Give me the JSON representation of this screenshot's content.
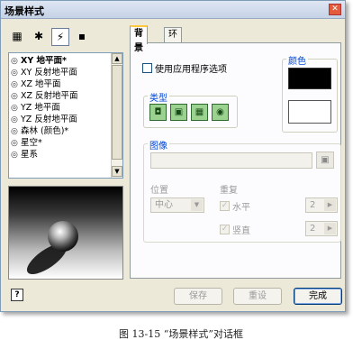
{
  "window": {
    "title": "场景样式",
    "close_glyph": "✕"
  },
  "left_toolbar": {
    "icons": [
      {
        "name": "scene-styles-icon",
        "glyph": "▦"
      },
      {
        "name": "lights-icon",
        "glyph": "✱"
      },
      {
        "name": "sunlight-icon",
        "glyph": "⚡"
      },
      {
        "name": "background-icon",
        "glyph": "▪"
      }
    ]
  },
  "scene_list": {
    "items": [
      {
        "label": "XY 地平面*",
        "selected": true
      },
      {
        "label": "XY 反射地平面",
        "selected": false
      },
      {
        "label": "XZ 地平面",
        "selected": false
      },
      {
        "label": "XZ 反射地平面",
        "selected": false
      },
      {
        "label": "YZ 地平面",
        "selected": false
      },
      {
        "label": "YZ 反射地平面",
        "selected": false
      },
      {
        "label": "森林 (颜色)*",
        "selected": false
      },
      {
        "label": "星空*",
        "selected": false
      },
      {
        "label": "星系",
        "selected": false
      }
    ]
  },
  "tabs": [
    {
      "label": "背景",
      "active": true
    },
    {
      "label": "环境",
      "active": false
    }
  ],
  "background_tab": {
    "use_app_options_label": "使用应用程序选项",
    "type_group_title": "类型",
    "type_buttons": [
      "◘",
      "▣",
      "▦",
      "◉"
    ],
    "color_group_title": "颜色",
    "colors": {
      "primary": "#000000",
      "secondary": "#ffffff"
    },
    "image_group_title": "图像",
    "image_value": "",
    "position_label": "位置",
    "position_value": "中心",
    "repeat_label": "重复",
    "horizontal_label": "水平",
    "horizontal_value": "2",
    "vertical_label": "竖直",
    "vertical_value": "2"
  },
  "buttons": {
    "help": "?",
    "save": "保存",
    "reset": "重设",
    "done": "完成"
  },
  "caption": "图 13-15 “场景样式”对话框"
}
